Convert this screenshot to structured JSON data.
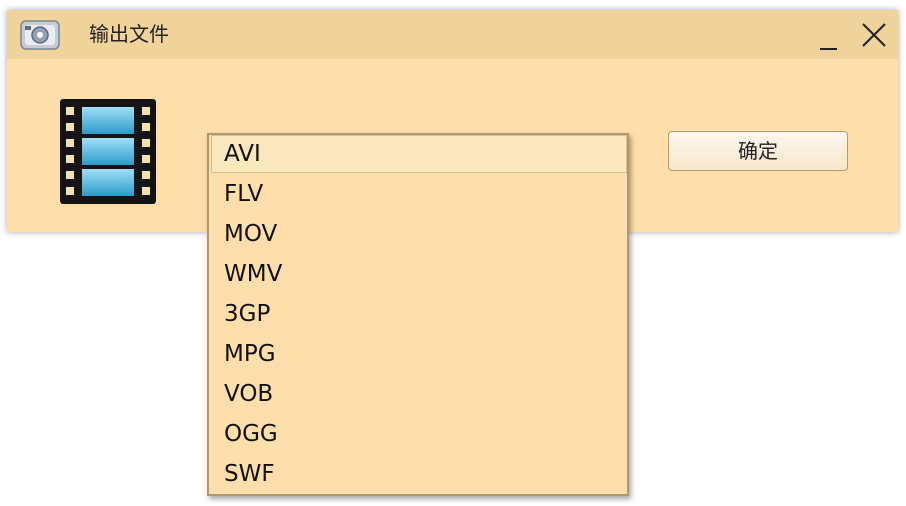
{
  "window": {
    "title": "输出文件",
    "app_icon": "video-converter-icon",
    "minimize_icon": "minimize-icon",
    "close_icon": "close-icon"
  },
  "content": {
    "file_type_icon": "film-strip-icon",
    "confirm_label": "确定"
  },
  "format_dropdown": {
    "selected": "AVI",
    "options": [
      "AVI",
      "FLV",
      "MOV",
      "WMV",
      "3GP",
      "MPG",
      "VOB",
      "OGG",
      "SWF"
    ]
  },
  "colors": {
    "window_bg": "#fedeaa",
    "titlebar_bg": "#f0d29b",
    "dropdown_border": "#b09870"
  }
}
